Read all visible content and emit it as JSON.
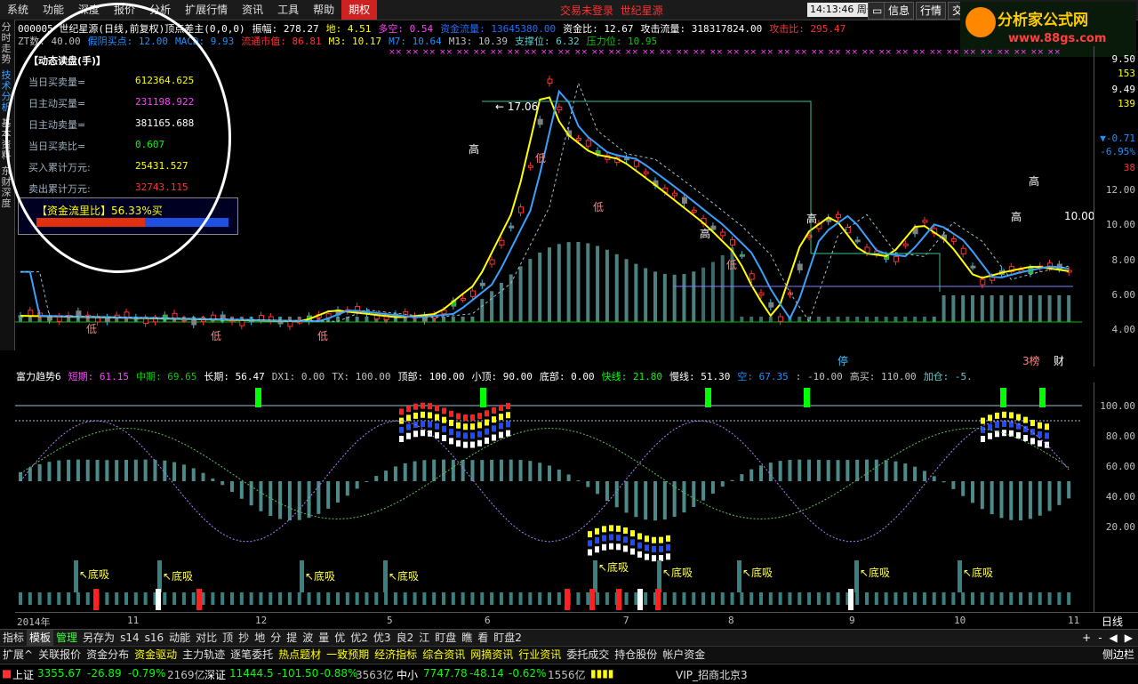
{
  "colors": {
    "up": "#ff3030",
    "down": "#00d000",
    "yellow": "#ffff00",
    "magenta": "#ff40ff",
    "cyan": "#60c0ff",
    "white": "#ffffff",
    "teal": "#5f9ea0",
    "blue": "#1e90ff",
    "green": "#00ff00"
  },
  "menubar": {
    "items": [
      "系统",
      "功能",
      "深度",
      "报价",
      "分析",
      "扩展行情",
      "资讯",
      "工具",
      "帮助",
      "期权"
    ],
    "active_index": 9,
    "trade_status": "交易未登录",
    "app_name": "世纪星源",
    "clock": "14:13:46",
    "weekday": "周一",
    "buttons": [
      "信息",
      "行情",
      "交"
    ]
  },
  "logo": {
    "line1": "分析家公式网",
    "line2": "www.88gs.com",
    "icon": "logo-badge-icon"
  },
  "sidetabs": [
    {
      "label": "分时走势",
      "active": false
    },
    {
      "label": "技术分析",
      "active": true
    },
    {
      "label": "基本资料",
      "active": false
    },
    {
      "label": "东财深度",
      "active": false
    }
  ],
  "chart_header": {
    "line1": [
      {
        "t": "000005 世纪星源(日线,前复权)顶点差主(0,0,0)",
        "c": "#ffffff"
      },
      {
        "t": "振幅: 278.27",
        "c": "#ffffff"
      },
      {
        "t": "地: 4.51",
        "c": "#ffff00"
      },
      {
        "t": "多空: 0.54",
        "c": "#ff40ff"
      },
      {
        "t": "资金流量: 13645380.00",
        "c": "#1e6fff"
      },
      {
        "t": "资金比: 12.67",
        "c": "#ffffff"
      },
      {
        "t": "攻击流量: 318317824.00",
        "c": "#ffffff"
      },
      {
        "t": "攻击比: 295.47",
        "c": "#ff3030"
      }
    ],
    "line2": [
      {
        "t": "ZT数: 40.00",
        "c": "#c0c0c0"
      },
      {
        "t": "假阴买点: 12.00",
        "c": "#1e90ff"
      },
      {
        "t": "MACD: 9.93",
        "c": "#1e90ff"
      },
      {
        "t": "流通市值: 86.81",
        "c": "#ff3030"
      },
      {
        "t": "M3: 10.17",
        "c": "#ffff00"
      },
      {
        "t": "M7: 10.64",
        "c": "#1e90ff"
      },
      {
        "t": "M13: 10.39",
        "c": "#c0c0c0"
      },
      {
        "t": "支撑位: 6.32",
        "c": "#5fd0d0"
      },
      {
        "t": "压力位: 10.95",
        "c": "#00d000"
      }
    ]
  },
  "order_panel": {
    "title": "【动态读盘(手)】",
    "rows": [
      {
        "label": "当日买卖量=",
        "value": "612364.625",
        "color": "#ffff00"
      },
      {
        "label": "日主动买量=",
        "value": "231198.922",
        "color": "#ff40ff"
      },
      {
        "label": "日主动卖量=",
        "value": "381165.688",
        "color": "#ffffff"
      },
      {
        "label": "当日买卖比=",
        "value": "0.607",
        "color": "#00ff00"
      },
      {
        "label": "买入累计万元:",
        "value": "25431.527",
        "color": "#ffff00"
      },
      {
        "label": "卖出累计万元:",
        "value": "32743.115",
        "color": "#ff3030"
      }
    ],
    "flow_label": "【资金流里比】56.33%买",
    "flow_buy_fraction": 0.5633
  },
  "main_axis": {
    "labels": [
      "9.50",
      "153",
      "9.49",
      "139",
      "-0.71",
      "-6.95%",
      "38",
      "12.00",
      "10.00",
      "8.00",
      "6.00",
      "4.00"
    ],
    "price_ticks": [
      "12.00",
      "10.00",
      "8.00",
      "6.00",
      "4.00"
    ],
    "extra_labels": [
      "9.50",
      "153",
      "9.49",
      "139",
      "▼-0.71",
      "-6.95%",
      "38"
    ]
  },
  "main_annotations": {
    "peak_price": "17.06",
    "high_label": "高",
    "low_label": "低",
    "stop_label": "停",
    "rank_label": "3榜",
    "fin_label": "财",
    "last_price_label": "10.00"
  },
  "sub_header": [
    {
      "t": "富力趋势6",
      "c": "#ffffff"
    },
    {
      "t": "短期: 61.15",
      "c": "#ff40ff"
    },
    {
      "t": "中期: 69.65",
      "c": "#00d000"
    },
    {
      "t": "长期: 56.47",
      "c": "#ffffff"
    },
    {
      "t": "DX1: 0.00",
      "c": "#c0c0c0"
    },
    {
      "t": "TX: 100.00",
      "c": "#c0c0c0"
    },
    {
      "t": "顶部: 100.00",
      "c": "#ffffff"
    },
    {
      "t": "小顶: 90.00",
      "c": "#ffffff"
    },
    {
      "t": "底部: 0.00",
      "c": "#ffffff"
    },
    {
      "t": "快线: 21.80",
      "c": "#00ff00"
    },
    {
      "t": "慢线: 51.30",
      "c": "#ffffff"
    },
    {
      "t": "空: 67.35",
      "c": "#1e90ff"
    },
    {
      "t": ": -10.00",
      "c": "#c0c0c0"
    },
    {
      "t": "高买: 110.00",
      "c": "#c0c0c0"
    },
    {
      "t": "加仓: -5.",
      "c": "#5fd0d0"
    }
  ],
  "sub_axis": [
    "100.00",
    "80.00",
    "60.00",
    "40.00",
    "20.00"
  ],
  "sub_annotations": {
    "bottom_buy": "底吸"
  },
  "date_axis": {
    "year": "2014年",
    "months": [
      "11",
      "12",
      "5",
      "6",
      "7",
      "8",
      "9",
      "10",
      "11"
    ],
    "period": "日线"
  },
  "bottom_tabs": {
    "items": [
      "指标",
      "模板",
      "管理",
      "另存为",
      "s14",
      "s16",
      "动能",
      "对比",
      "顶",
      "抄",
      "地",
      "分",
      "提",
      "波",
      "量",
      "优",
      "优2",
      "优3",
      "良2",
      "江",
      "盯盘",
      "瞧",
      "看",
      "盯盘2"
    ],
    "active_index": 1,
    "right_icons": [
      "+",
      "-",
      "◀",
      "▶"
    ]
  },
  "func_bar": {
    "items": [
      {
        "t": "扩展^",
        "c": "#e0e0e0"
      },
      {
        "t": "关联报价",
        "c": "#e0e0e0"
      },
      {
        "t": "资金分布",
        "c": "#e0e0e0"
      },
      {
        "t": "资金驱动",
        "c": "#ffff00"
      },
      {
        "t": "主力轨迹",
        "c": "#e0e0e0"
      },
      {
        "t": "逐笔委托",
        "c": "#e0e0e0"
      },
      {
        "t": "热点题材",
        "c": "#ffff00"
      },
      {
        "t": "一致预期",
        "c": "#ffff00"
      },
      {
        "t": "经济指标",
        "c": "#ffff00"
      },
      {
        "t": "综合资讯",
        "c": "#ffff00"
      },
      {
        "t": "网摘资讯",
        "c": "#ffff00"
      },
      {
        "t": "行业资讯",
        "c": "#ffff00"
      },
      {
        "t": "委托成交",
        "c": "#e0e0e0"
      },
      {
        "t": "持仓股份",
        "c": "#e0e0e0"
      },
      {
        "t": "帐户资金",
        "c": "#e0e0e0"
      }
    ],
    "right": "侧边栏"
  },
  "status_bar": {
    "sh_name": "上证",
    "sh_val": "3355.67",
    "sh_chg": "-26.89",
    "sh_pct": "-0.79%",
    "sh_amt": "2169亿",
    "sz_name": "深证",
    "sz_val": "11444.5",
    "sz_chg": "-101.50",
    "sz_pct": "-0.88%",
    "sz_amt": "3563亿",
    "zx_name": "中小",
    "zx_val": "7747.78",
    "zx_chg": "-48.14",
    "zx_pct": "-0.62%",
    "zx_amt": "1556亿",
    "vip": "VIP_招商北京3"
  }
}
